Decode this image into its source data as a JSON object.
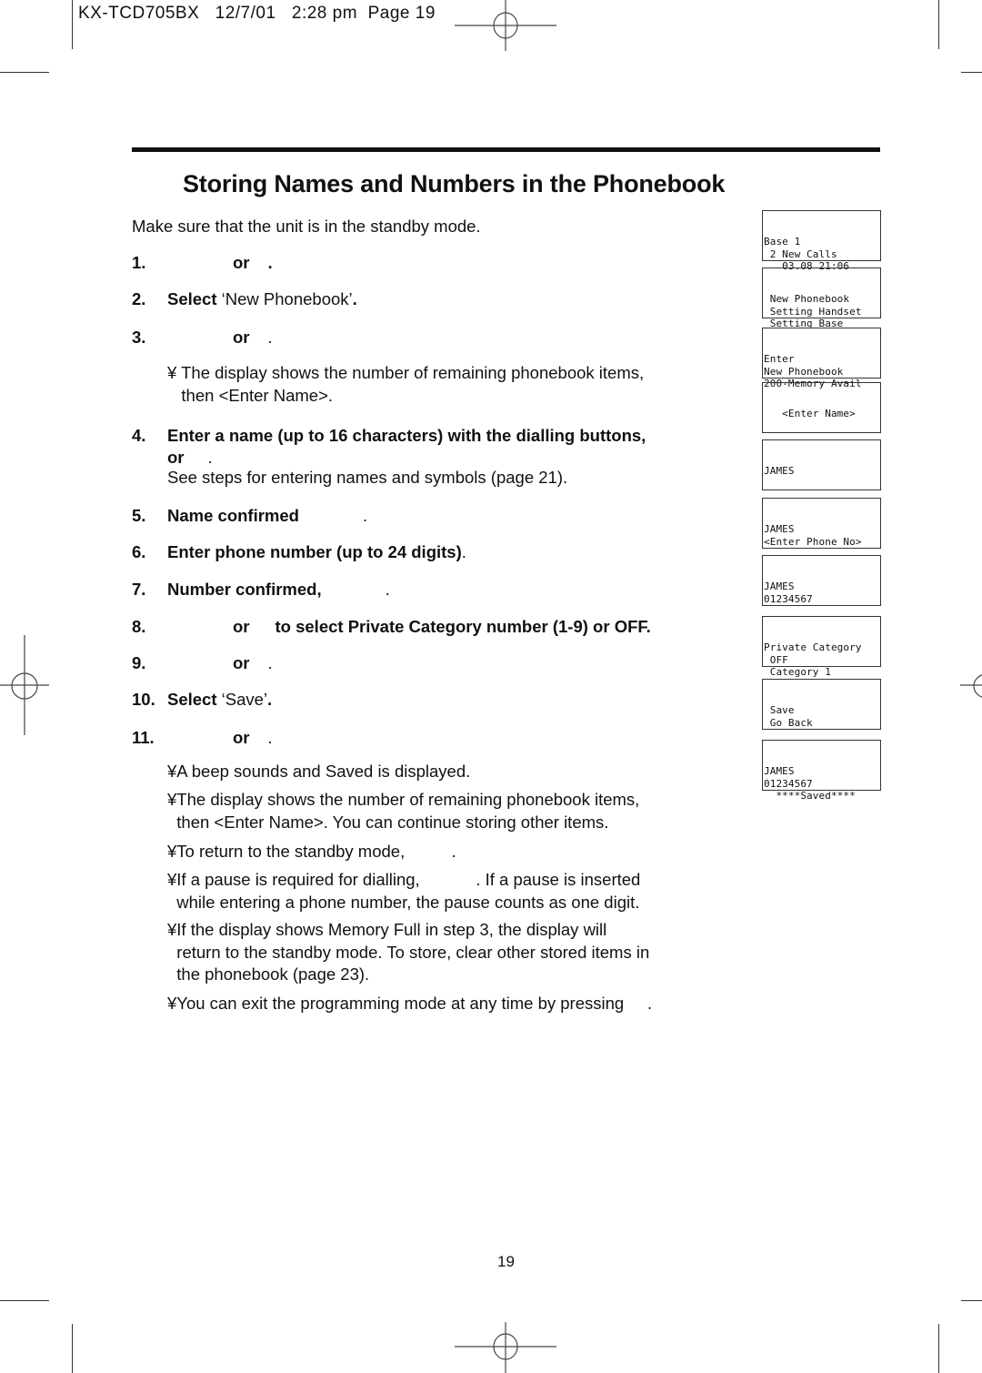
{
  "header": {
    "model": "KX-TCD705BX",
    "date": "12/7/01",
    "time": "2:28 pm",
    "page_label": "Page 19"
  },
  "title": "Storing Names and Numbers in the Phonebook",
  "intro": "Make sure that the unit is in the standby mode.",
  "steps": [
    {
      "num": "1.",
      "text": "or",
      "tail": "."
    },
    {
      "num": "2.",
      "bold": "Select ",
      "regular": "‘New Phonebook’",
      "tail": "."
    },
    {
      "num": "3.",
      "text": "or",
      "tail": "."
    },
    {
      "num": "4.",
      "line1": "Enter a name (up to 16 characters) with the dialling buttons,",
      "line2": "or",
      "tail": "."
    },
    {
      "num": "5.",
      "text": "Name confirmed",
      "tail": "."
    },
    {
      "num": "6.",
      "text": "Enter phone number (up to 24 digits)",
      "tail": "."
    },
    {
      "num": "7.",
      "text": "Number confirmed,",
      "tail": "."
    },
    {
      "num": "8.",
      "text": "or",
      "rest": "to select Private Category number (1-9) or OFF."
    },
    {
      "num": "9.",
      "text": "or",
      "tail": "."
    },
    {
      "num": "10.",
      "bold": "Select ",
      "regular": "‘Save’",
      "tail": "."
    },
    {
      "num": "11.",
      "text": "or",
      "tail": "."
    }
  ],
  "step3_note": {
    "bullet": "¥",
    "line1": "The display shows the number of remaining phonebook items,",
    "line2": "then <Enter Name>."
  },
  "step4_note": "See steps for entering names and symbols (page 21).",
  "final_notes": [
    {
      "bullet": "¥",
      "lines": [
        "A beep sounds and Saved is displayed."
      ]
    },
    {
      "bullet": "¥",
      "lines": [
        "The display shows the number of remaining phonebook items,",
        "then <Enter Name>. You can continue storing other items."
      ]
    },
    {
      "bullet": "¥",
      "lines": [
        "To return to the standby mode,          ."
      ]
    },
    {
      "bullet": "¥",
      "lines": [
        "If a pause is required for dialling,            . If a pause is inserted",
        "while entering a phone number, the pause counts as one digit."
      ]
    },
    {
      "bullet": "¥",
      "lines": [
        "If the display shows Memory Full in step 3, the display will",
        "return to the standby mode. To store, clear other stored items in",
        "the phonebook (page 23)."
      ]
    },
    {
      "bullet": "¥",
      "lines": [
        "You can exit the programming mode at any time by pressing     ."
      ]
    }
  ],
  "lcd_displays": [
    {
      "lines": [
        "Base 1",
        " 2 New Calls",
        "   03.08 21:06"
      ]
    },
    {
      "lines": [
        " New Phonebook",
        " Setting Handset",
        " Setting Base"
      ]
    },
    {
      "lines": [
        "Enter",
        "New Phonebook",
        "200-Memory Avail"
      ]
    },
    {
      "lines": [
        "   <Enter Name>"
      ]
    },
    {
      "lines": [
        "JAMES"
      ]
    },
    {
      "lines": [
        "JAMES",
        "<Enter Phone No>"
      ]
    },
    {
      "lines": [
        "JAMES",
        "01234567"
      ]
    },
    {
      "lines": [
        "Private Category",
        " OFF",
        " Category 1"
      ]
    },
    {
      "lines": [
        " Save",
        " Go Back"
      ]
    },
    {
      "lines": [
        "JAMES",
        "01234567",
        "  ****Saved****"
      ]
    }
  ],
  "page_number": "19"
}
